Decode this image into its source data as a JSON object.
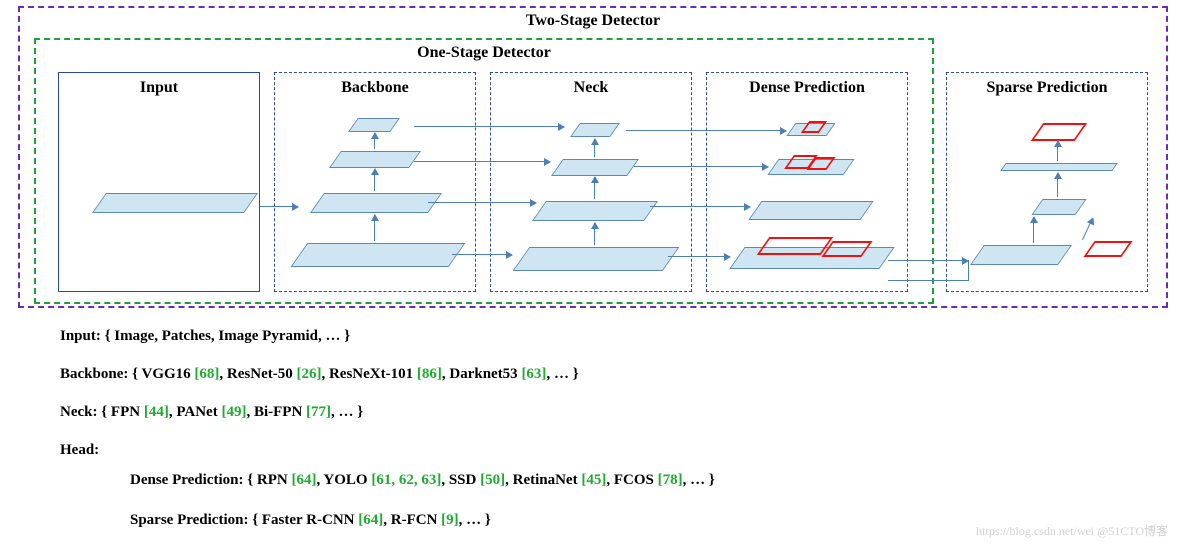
{
  "outer_title": "Two-Stage Detector",
  "inner_title": "One-Stage Detector",
  "blocks": {
    "input": "Input",
    "backbone": "Backbone",
    "neck": "Neck",
    "dense": "Dense Prediction",
    "sparse": "Sparse Prediction"
  },
  "lines": {
    "input": {
      "label": "Input:",
      "body": " { Image, Patches, Image Pyramid, … }"
    },
    "backbone": {
      "label": "Backbone:",
      "parts": [
        " { VGG16 ",
        "[68]",
        ", ResNet-50 ",
        "[26]",
        ", ResNeXt-101 ",
        "[86]",
        ", Darknet53 ",
        "[63]",
        ", … }"
      ]
    },
    "neck": {
      "label": "Neck:",
      "parts": [
        " { FPN ",
        "[44]",
        ", PANet ",
        "[49]",
        ", Bi-FPN ",
        "[77]",
        ", … }"
      ]
    },
    "head": {
      "label": "Head:"
    },
    "dense": {
      "label": "Dense Prediction:",
      "parts": [
        " { RPN ",
        "[64]",
        ", YOLO ",
        "[61, 62, 63]",
        ", SSD ",
        "[50]",
        ", RetinaNet ",
        "[45]",
        ", FCOS ",
        "[78]",
        ", … }"
      ]
    },
    "sparse": {
      "label": "Sparse Prediction:",
      "parts": [
        " { Faster R-CNN ",
        "[64]",
        ",  R-FCN ",
        "[9]",
        ", … }"
      ]
    }
  },
  "watermark": "https://blog.csdn.net/wei @51CTO博客"
}
